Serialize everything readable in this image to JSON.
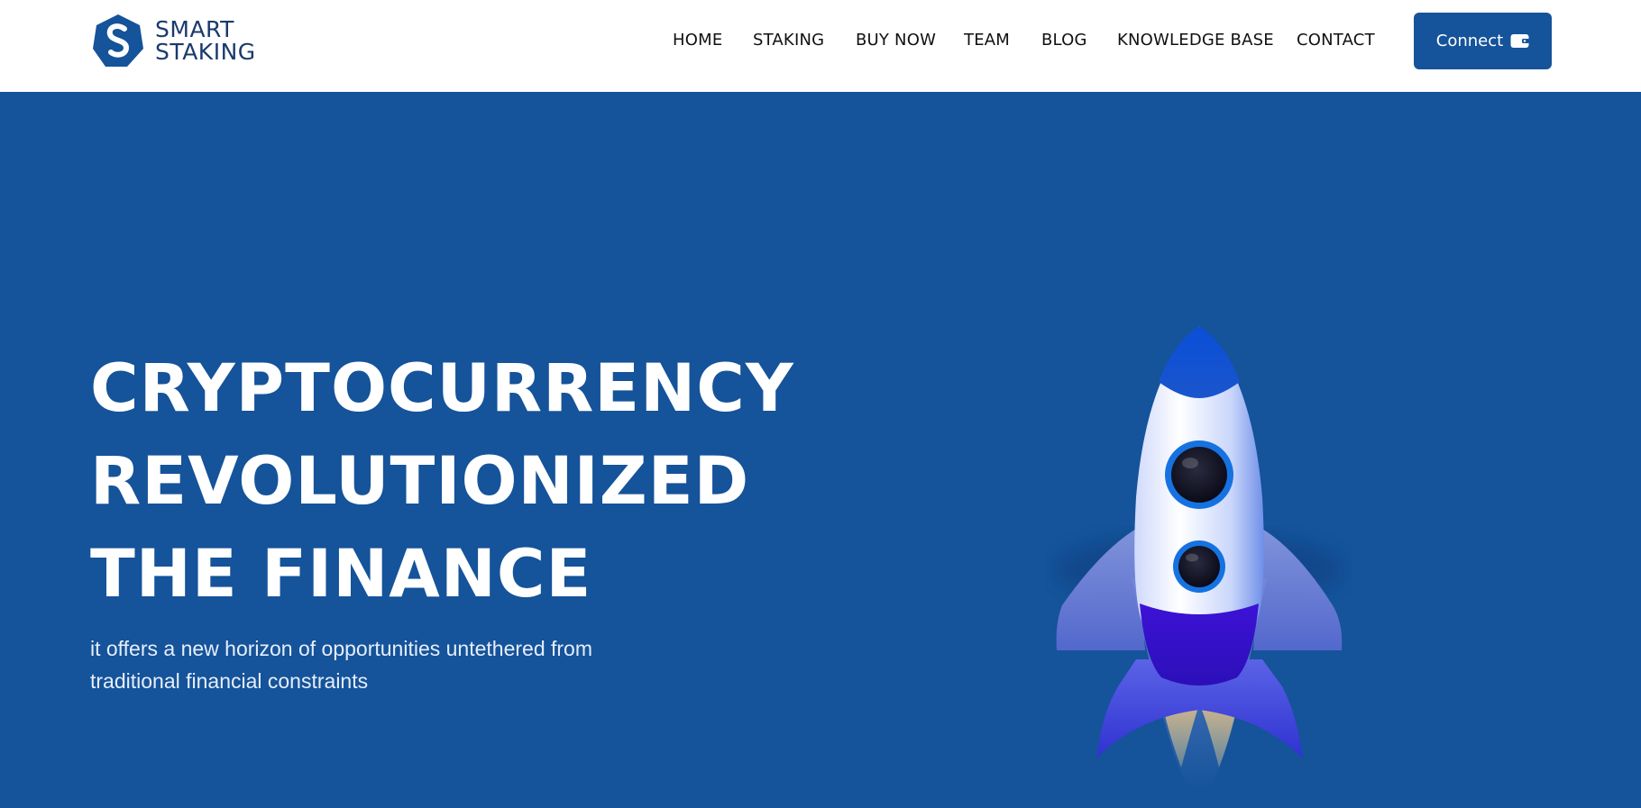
{
  "header": {
    "logo_line1": "SMART",
    "logo_line2": "STAKING",
    "nav": [
      "HOME",
      "STAKING",
      "BUY NOW",
      "TEAM",
      "BLOG",
      "KNOWLEDGE BASE",
      "CONTACT"
    ],
    "connect_label": "Connect"
  },
  "hero": {
    "title_lines": [
      "CRYPTOCURRENCY",
      "REVOLUTIONIZED",
      "THE FINANCE"
    ],
    "subtitle_line1": "it offers a new horizon of opportunities untethered from",
    "subtitle_line2": "traditional financial constraints"
  },
  "colors": {
    "brand_blue": "#15539a",
    "header_bg": "#ffffff",
    "text_dark": "#111111"
  },
  "icons": {
    "logo": "smart-staking-logo-icon",
    "wallet": "wallet-icon",
    "rocket": "rocket-illustration"
  }
}
